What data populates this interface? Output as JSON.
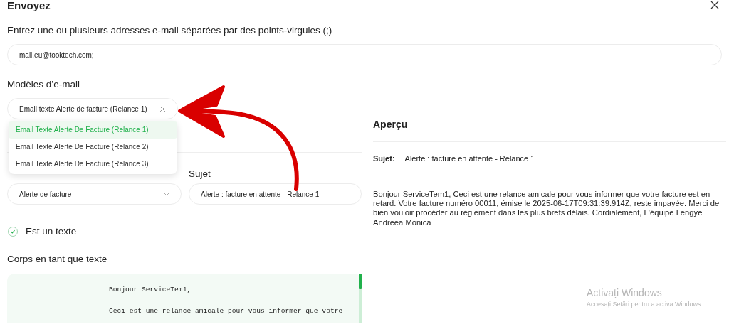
{
  "dialog": {
    "title": "Envoyez"
  },
  "recipients": {
    "label": "Entrez une ou plusieurs adresses e-mail séparées par des points-virgules (;)",
    "value": "mail.eu@tooktech.com;"
  },
  "templates": {
    "label": "Modèles d’e-mail",
    "value": "Email texte Alerte de facture (Relance 1)",
    "options": [
      {
        "label": "Email Texte Alerte De Facture (Relance 1)",
        "selected": true
      },
      {
        "label": "Email Texte Alerte De Facture (Relance 2)",
        "selected": false
      },
      {
        "label": "Email Texte Alerte De Facture (Relance 3)",
        "selected": false
      }
    ]
  },
  "category": {
    "value": "Alerte de facture"
  },
  "subject": {
    "label": "Sujet",
    "value": "Alerte : facture en attente - Relance 1"
  },
  "is_text": {
    "label": "Est un texte",
    "checked": true
  },
  "body": {
    "label": "Corps en tant que texte",
    "paragraphs": [
      "Bonjour ServiceTem1,",
      "Ceci est une relance amicale pour vous informer que votre"
    ]
  },
  "preview": {
    "title": "Aperçu",
    "subject_label": "Sujet:",
    "subject": "Alerte : facture en attente - Relance 1",
    "body": "Bonjour ServiceTem1, Ceci est une relance amicale pour vous informer que votre facture est en retard. Votre facture numéro 00011, émise le 2025-06-17T09:31:39.914Z, reste impayée. Merci de bien vouloir procéder au règlement dans les plus brefs délais. Cordialement, L'équipe Lengyel Andreea Monica"
  },
  "watermark": {
    "title": "Activați Windows",
    "subtitle": "Accesați Setări pentru a activa Windows."
  }
}
